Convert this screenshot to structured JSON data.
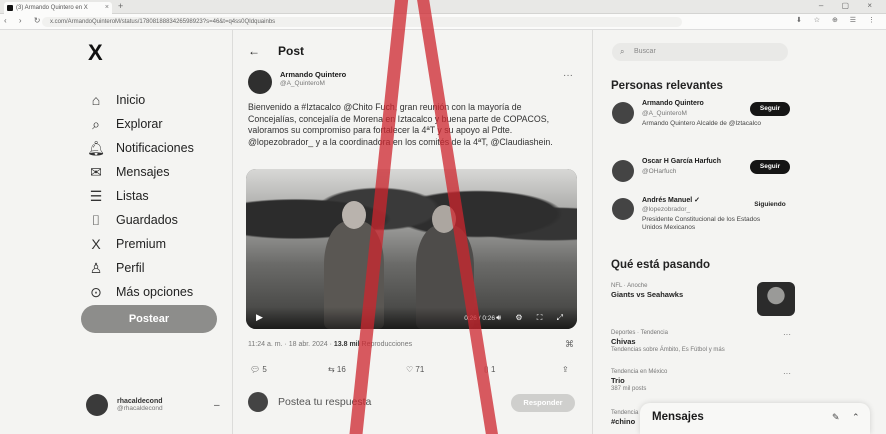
{
  "browser": {
    "tab_title": "(3) Armando Quintero en X",
    "tab_close": "×",
    "new_tab": "+",
    "window_controls": "–  ▢  ×",
    "nav_buttons": "‹ › ↻ ⌂",
    "url": "x.com/ArmandoQuinteroM/status/1780818883426598923?s=46&t=q4ss0QIdquainbs",
    "extensions": "⬇ ☆ ⊕ ☰ ⋮"
  },
  "sidebar": {
    "logo": "X",
    "items": [
      {
        "label": "Inicio",
        "icon": "home-icon",
        "glyph": "⌂"
      },
      {
        "label": "Explorar",
        "icon": "search-icon",
        "glyph": "⌕"
      },
      {
        "label": "Notificaciones",
        "icon": "bell-icon",
        "glyph": "🔔︎"
      },
      {
        "label": "Mensajes",
        "icon": "envelope-icon",
        "glyph": "✉"
      },
      {
        "label": "Listas",
        "icon": "list-icon",
        "glyph": "☰"
      },
      {
        "label": "Guardados",
        "icon": "bookmark-icon",
        "glyph": "⌷"
      },
      {
        "label": "Premium",
        "icon": "x-logo-icon",
        "glyph": "X"
      },
      {
        "label": "Perfil",
        "icon": "person-icon",
        "glyph": "♙"
      },
      {
        "label": "Más opciones",
        "icon": "more-circle-icon",
        "glyph": "⊙"
      }
    ],
    "post_button": "Postear",
    "account_name": "rhacaldecond",
    "account_handle": "@rhacaldecond",
    "account_more": "–"
  },
  "post": {
    "back_glyph": "←",
    "header_title": "Post",
    "author_name": "Armando Quintero",
    "author_handle": "@A_QuinteroM",
    "more_glyph": "···",
    "text": "Bienvenido a #Iztacalco @Chito Fuch, gran reunión con la mayoría de Concejalías, concejalía de Morena en Iztacalco y buena parte de COPACOS, valoramos su compromiso para fortalecer la 4ªT y su apoyo al Pdte. @lopezobrador_ y a la coordinadora en los comités de la 4ªT, @Claudiashein.",
    "video_play": "▶",
    "video_time": "0:26 / 0:26",
    "video_icons": "🔊︎ ⚙ ⛶ ⤢",
    "meta_time": "11:24 a. m. · 18 abr. 2024 · ",
    "meta_views": "13.8 mil",
    "meta_views_label": " Reproducciones",
    "meta_icon": "⌘",
    "actions": {
      "reply": "💬︎ 5",
      "repost": "⇆ 16",
      "like": "♡ 71",
      "bookmark": "⌷ 1",
      "share": "⇪"
    },
    "reply_placeholder": "Postea tu respuesta",
    "reply_button": "Responder"
  },
  "right": {
    "search_icon": "⌕",
    "search_placeholder": "Buscar",
    "people_title": "Personas relevantes",
    "people": [
      {
        "name": "Armando Quintero",
        "handle": "@A_QuinteroM",
        "bio": "Armando Quintero Alcalde de @Iztacalco",
        "action": "Seguir"
      },
      {
        "name": "Oscar H García Harfuch",
        "handle": "@OHarfuch",
        "bio": "",
        "action": "Seguir"
      },
      {
        "name": "Andrés Manuel ✓",
        "handle": "@lopezobrador_",
        "bio": "Presidente Constitucional de los Estados Unidos Mexicanos",
        "action": "Siguiendo"
      }
    ],
    "trends_title": "Qué está pasando",
    "trends": [
      {
        "category": "NFL · Anoche",
        "title": "Giants vs Seahawks",
        "sub": "",
        "more": ""
      },
      {
        "category": "Deportes · Tendencia",
        "title": "Chivas",
        "sub": "Tendencias sobre Ámbito, Es Fútbol y más",
        "more": "···"
      },
      {
        "category": "Tendencia en México",
        "title": "Trio",
        "sub": "387 mil posts",
        "more": "···"
      },
      {
        "category": "Tendencia",
        "title": "#chino",
        "sub": "",
        "more": ""
      }
    ],
    "messages_title": "Mensajes",
    "messages_icons": [
      "✎",
      "⌃"
    ]
  }
}
